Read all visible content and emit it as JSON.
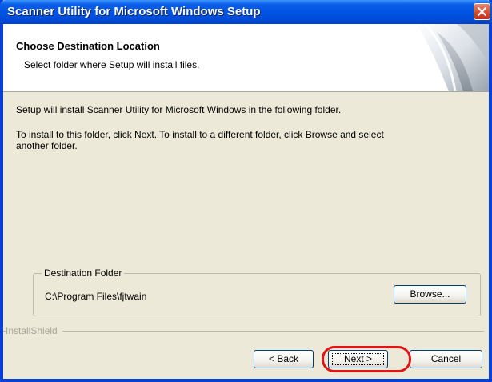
{
  "window": {
    "title": "Scanner Utility for Microsoft Windows Setup"
  },
  "header": {
    "title": "Choose Destination Location",
    "subtitle": "Select folder where Setup will install files."
  },
  "body": {
    "line1": "Setup will install Scanner Utility for Microsoft Windows in the following folder.",
    "line2": "To install to this folder, click Next. To install to a different folder, click Browse and select",
    "line3": "another folder."
  },
  "destination": {
    "group_label": "Destination Folder",
    "path": "C:\\Program Files\\fjtwain",
    "browse_label": "Browse..."
  },
  "footer": {
    "brand": "InstallShield",
    "back_label": "< Back",
    "next_label": "Next >",
    "cancel_label": "Cancel"
  },
  "colors": {
    "titlebar": "#0054e3",
    "dialog_bg": "#ece9d8",
    "highlight": "#e01515"
  },
  "icons": {
    "close": "close-icon",
    "header_graphic": "setup-wizard-graphic"
  }
}
